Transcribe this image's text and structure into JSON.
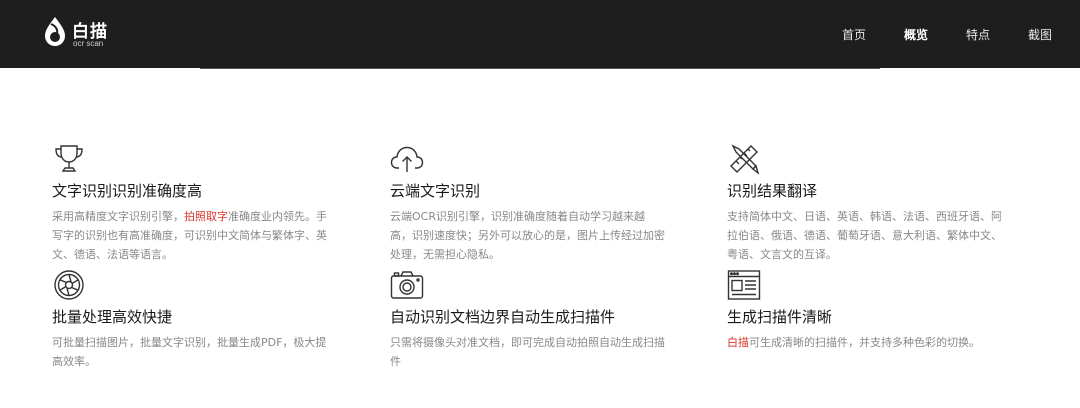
{
  "header": {
    "brand": "白描",
    "brand_sub": "ocr scan",
    "nav": [
      {
        "label": "首页"
      },
      {
        "label": "概览"
      },
      {
        "label": "特点"
      },
      {
        "label": "截图"
      }
    ]
  },
  "features": [
    {
      "icon": "trophy-icon",
      "title": "文字识别识别准确度高",
      "desc_pre": "采用高精度文字识别引擎，",
      "desc_highlight": "拍照取字",
      "desc_post": "准确度业内领先。手写字的识别也有高准确度，可识别中文简体与繁体字、英文、德语、法语等语言。"
    },
    {
      "icon": "cloud-upload-icon",
      "title": "云端文字识别",
      "desc": "云端OCR识别引擎，识别准确度随着自动学习越来越高，识别速度快；另外可以放心的是，图片上传经过加密处理，无需担心隐私。"
    },
    {
      "icon": "pencil-ruler-icon",
      "title": "识别结果翻译",
      "desc": "支持简体中文、日语、英语、韩语、法语、西班牙语、阿拉伯语、俄语、德语、葡萄牙语、意大利语、繁体中文、粤语、文言文的互译。"
    },
    {
      "icon": "aperture-icon",
      "title": "批量处理高效快捷",
      "desc": "可批量扫描图片，批量文字识别，批量生成PDF，极大提高效率。"
    },
    {
      "icon": "camera-icon",
      "title": "自动识别文档边界自动生成扫描件",
      "desc": "只需将摄像头对准文档，即可完成自动拍照自动生成扫描件"
    },
    {
      "icon": "browser-window-icon",
      "title": "生成扫描件清晰",
      "desc_highlight": "白描",
      "desc_post": "可生成清晰的扫描件，并支持多种色彩的切换。"
    }
  ],
  "colors": {
    "header_bg": "#1e1e1e",
    "highlight": "#d9362b",
    "desc_text": "#888888"
  }
}
